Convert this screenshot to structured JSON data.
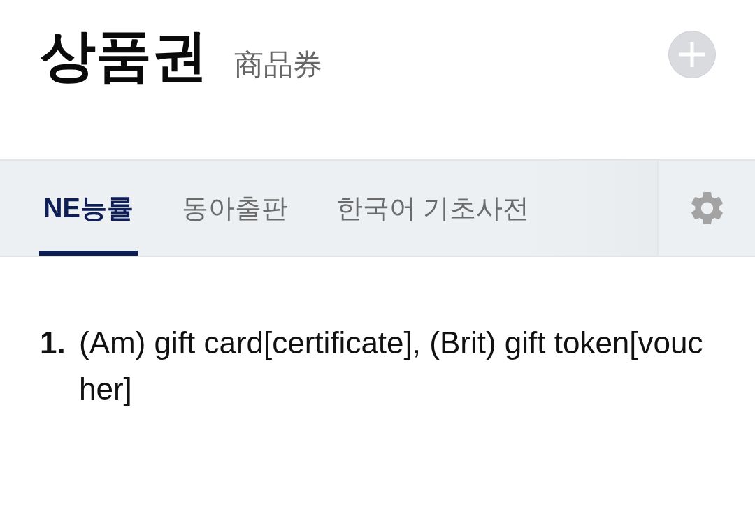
{
  "header": {
    "headword": "상품권",
    "hanja": "商品券"
  },
  "tabs": [
    {
      "label": "NE능률",
      "selected": true
    },
    {
      "label": "동아출판",
      "selected": false
    },
    {
      "label": "한국어 기초사전",
      "selected": false
    }
  ],
  "definitions": [
    {
      "number": "1.",
      "text": "(Am) gift card[certificate], (Brit) gift token[voucher]"
    }
  ]
}
